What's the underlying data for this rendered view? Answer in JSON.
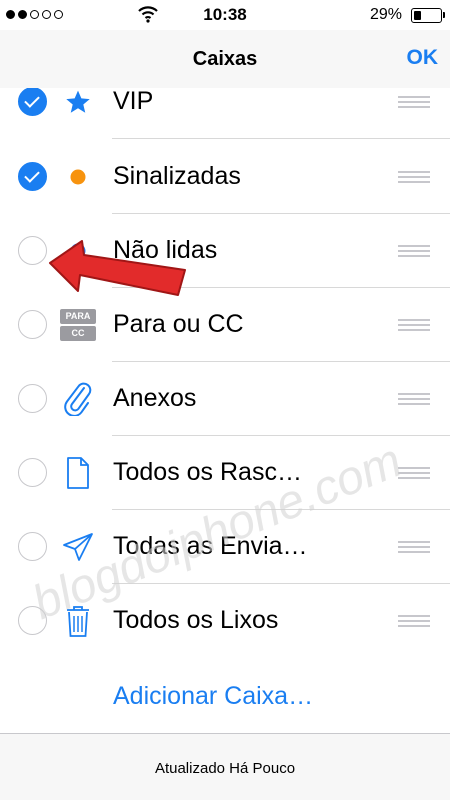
{
  "status_bar": {
    "time": "10:38",
    "battery_percent": "29%"
  },
  "nav": {
    "title": "Caixas",
    "ok_label": "OK"
  },
  "mailboxes": [
    {
      "label": "VIP",
      "checked": true,
      "icon": "star-icon",
      "color": "#1a7ef1"
    },
    {
      "label": "Sinalizadas",
      "checked": true,
      "icon": "orange-dot-icon",
      "color": "#f7930e"
    },
    {
      "label": "Não lidas",
      "checked": false,
      "icon": "blue-dot-icon",
      "color": "#1a7ef1"
    },
    {
      "label": "Para ou CC",
      "checked": false,
      "icon": "to-cc-icon",
      "badge_top": "PARA",
      "badge_bottom": "CC"
    },
    {
      "label": "Anexos",
      "checked": false,
      "icon": "paperclip-icon"
    },
    {
      "label": "Todos os Rasc…",
      "checked": false,
      "icon": "document-icon"
    },
    {
      "label": "Todas as Envia…",
      "checked": false,
      "icon": "paper-plane-icon"
    },
    {
      "label": "Todos os Lixos",
      "checked": false,
      "icon": "trash-icon"
    }
  ],
  "add_mailbox_label": "Adicionar Caixa…",
  "footer": {
    "status": "Atualizado Há Pouco"
  },
  "watermark": "blogdoiphone.com",
  "colors": {
    "accent": "#1a7ef1",
    "flag": "#f7930e",
    "annotation_arrow": "#e22b2b"
  }
}
